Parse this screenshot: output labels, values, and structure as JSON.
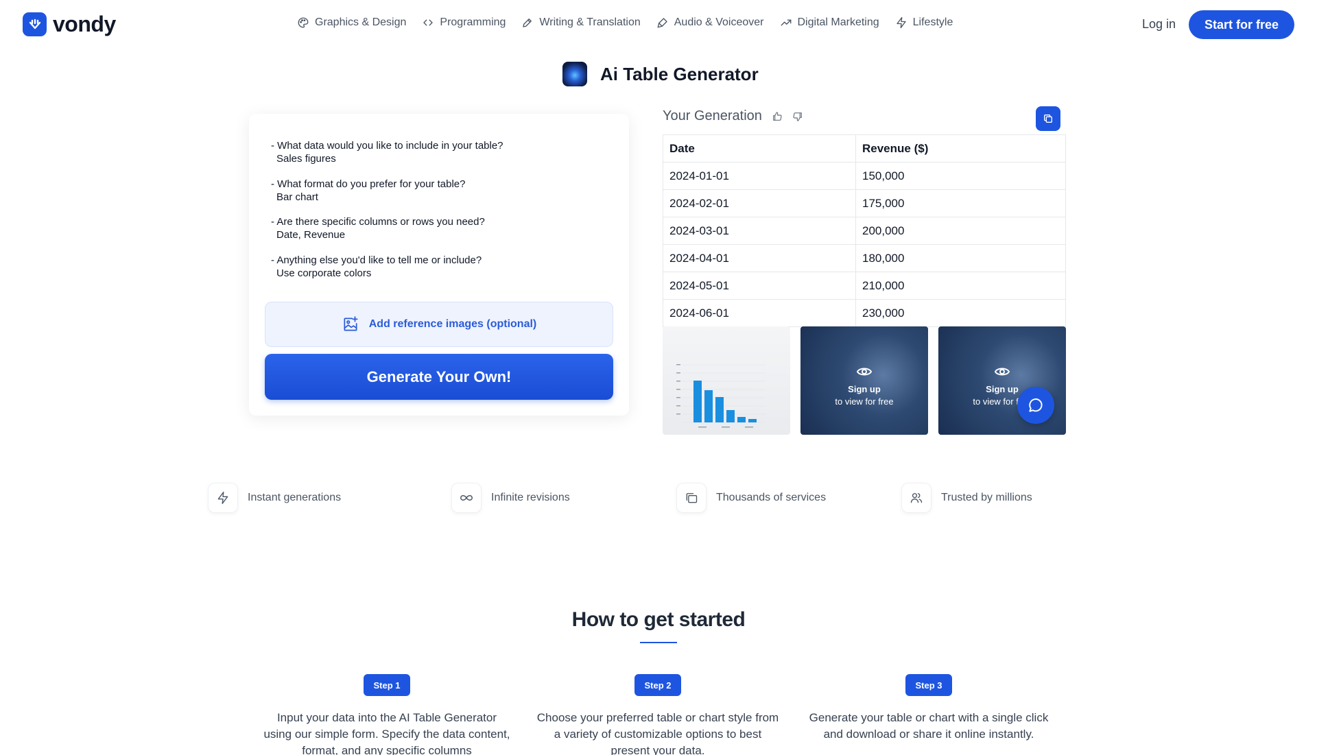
{
  "brand": {
    "name": "vondy",
    "accent": "#1e55e0"
  },
  "nav": [
    {
      "label": "Graphics & Design",
      "icon": "palette-icon"
    },
    {
      "label": "Programming",
      "icon": "code-icon"
    },
    {
      "label": "Writing & Translation",
      "icon": "pen-icon"
    },
    {
      "label": "Audio & Voiceover",
      "icon": "microphone-icon"
    },
    {
      "label": "Digital Marketing",
      "icon": "trending-up-icon"
    },
    {
      "label": "Lifestyle",
      "icon": "lightning-icon"
    }
  ],
  "header": {
    "login": "Log in",
    "start": "Start for free"
  },
  "page": {
    "title": "Ai Table Generator"
  },
  "form": {
    "items": [
      {
        "q": "- What data would you like to include in your table?",
        "a": "Sales figures"
      },
      {
        "q": "- What format do you prefer for your table?",
        "a": "Bar chart"
      },
      {
        "q": "- Are there specific columns or rows you need?",
        "a": "Date, Revenue"
      },
      {
        "q": "- Anything else you'd like to tell me or include?",
        "a": "Use corporate colors"
      }
    ],
    "ref_button": "Add reference images (optional)",
    "generate_button": "Generate Your Own!"
  },
  "generation": {
    "title": "Your Generation",
    "table": {
      "headers": [
        "Date",
        "Revenue ($)"
      ],
      "rows": [
        [
          "2024-01-01",
          "150,000"
        ],
        [
          "2024-02-01",
          "175,000"
        ],
        [
          "2024-03-01",
          "200,000"
        ],
        [
          "2024-04-01",
          "180,000"
        ],
        [
          "2024-05-01",
          "210,000"
        ],
        [
          "2024-06-01",
          "230,000"
        ]
      ]
    },
    "locked": {
      "line1": "Sign up",
      "line2": "to view for free"
    }
  },
  "features": [
    {
      "label": "Instant generations",
      "icon": "lightning-icon"
    },
    {
      "label": "Infinite revisions",
      "icon": "infinity-icon"
    },
    {
      "label": "Thousands of services",
      "icon": "folders-icon"
    },
    {
      "label": "Trusted by millions",
      "icon": "users-icon"
    }
  ],
  "how": {
    "title": "How to get started",
    "steps": [
      {
        "badge": "Step 1",
        "text": "Input your data into the AI Table Generator using our simple form. Specify the data content, format, and any specific columns"
      },
      {
        "badge": "Step 2",
        "text": "Choose your preferred table or chart style from a variety of customizable options to best present your data."
      },
      {
        "badge": "Step 3",
        "text": "Generate your table or chart with a single click and download or share it online instantly."
      }
    ]
  }
}
